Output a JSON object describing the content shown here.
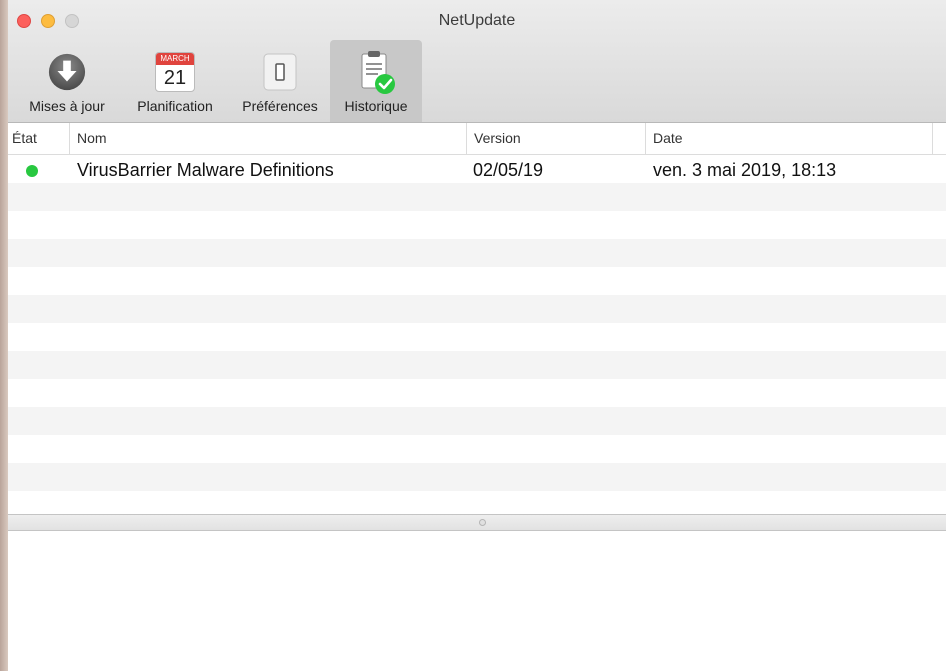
{
  "window": {
    "title": "NetUpdate"
  },
  "toolbar": {
    "items": [
      {
        "label": "Mises à jour",
        "icon": "download-icon",
        "selected": false
      },
      {
        "label": "Planification",
        "icon": "calendar-icon",
        "selected": false,
        "calendar_month": "MARCH",
        "calendar_day": "21"
      },
      {
        "label": "Préférences",
        "icon": "switch-icon",
        "selected": false
      },
      {
        "label": "Historique",
        "icon": "clipboard-check-icon",
        "selected": true
      }
    ]
  },
  "table": {
    "columns": [
      "État",
      "Nom",
      "Version",
      "Date"
    ],
    "rows": [
      {
        "status": "green",
        "name": "VirusBarrier Malware Definitions",
        "version": "02/05/19",
        "date": "ven. 3 mai 2019, 18:13"
      }
    ]
  },
  "colors": {
    "status_ok": "#28c840",
    "selected_tab": "#c8c8c8",
    "row_alt": "#f4f4f4"
  }
}
